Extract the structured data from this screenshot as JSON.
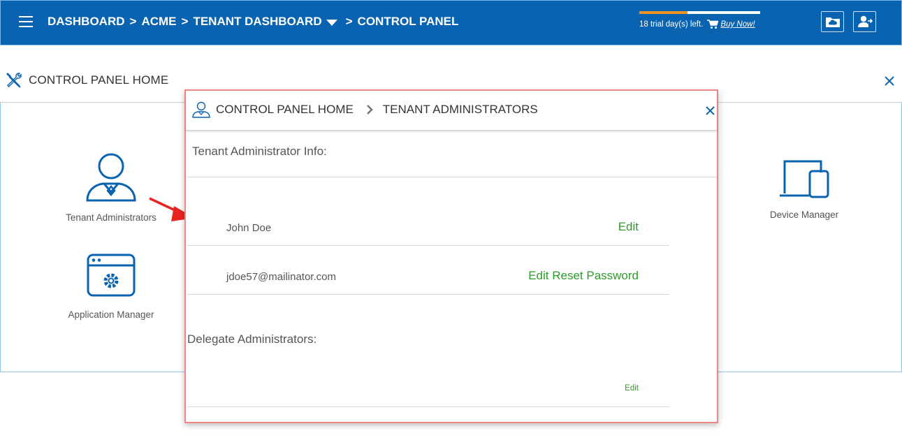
{
  "topbar": {
    "breadcrumb": [
      "DASHBOARD",
      "ACME",
      "TENANT DASHBOARD",
      "CONTROL PANEL"
    ],
    "separator": ">",
    "trial_progress": 0.4,
    "trial_text": "18 trial day(s) left.",
    "buy_now": "Buy Now!",
    "colors": {
      "bar": "#0a63b0",
      "trial_fill": "#f0921f"
    }
  },
  "control_panel": {
    "title": "CONTROL PANEL HOME",
    "tiles": [
      {
        "label": "Tenant Administrators",
        "icon": "user-admin-icon"
      },
      {
        "label": "Application Manager",
        "icon": "application-settings-icon"
      },
      {
        "label": "Device Manager",
        "icon": "devices-icon"
      }
    ]
  },
  "dialog": {
    "breadcrumb_home": "CONTROL PANEL HOME",
    "breadcrumb_current": "TENANT ADMINISTRATORS",
    "info_title": "Tenant Administrator Info:",
    "name": "John Doe",
    "name_action": "Edit",
    "email": "jdoe57@mailinator.com",
    "email_action": "Edit Reset Password",
    "delegates_title": "Delegate Administrators:",
    "delegates_action": "Edit",
    "colors": {
      "link": "#2e9a2e",
      "border": "#ee8686"
    }
  }
}
